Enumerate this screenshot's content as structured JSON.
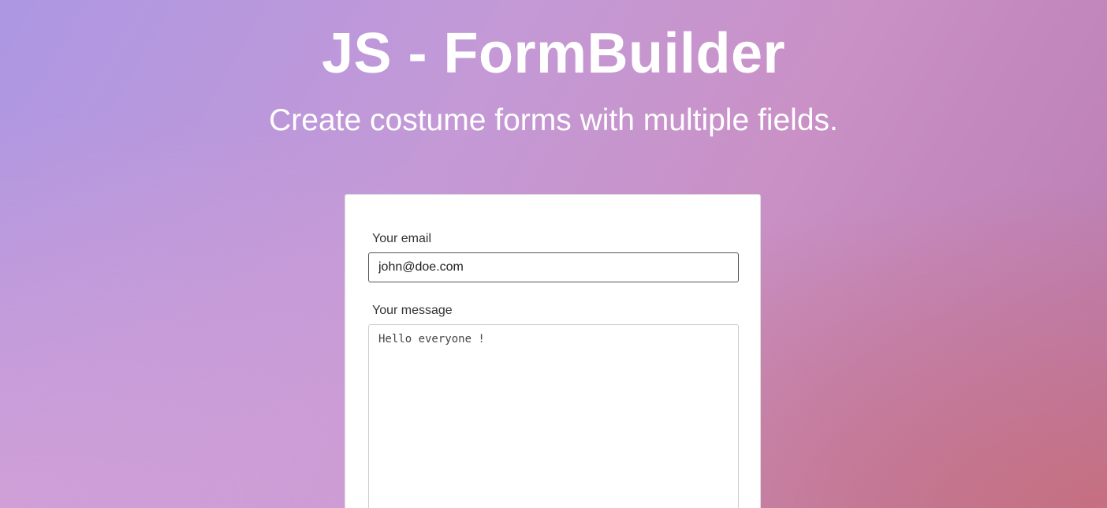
{
  "header": {
    "title": "JS - FormBuilder",
    "subtitle": "Create costume forms with multiple fields."
  },
  "form": {
    "email": {
      "label": "Your email",
      "value": "john@doe.com"
    },
    "message": {
      "label": "Your message",
      "value": "Hello everyone !"
    }
  }
}
